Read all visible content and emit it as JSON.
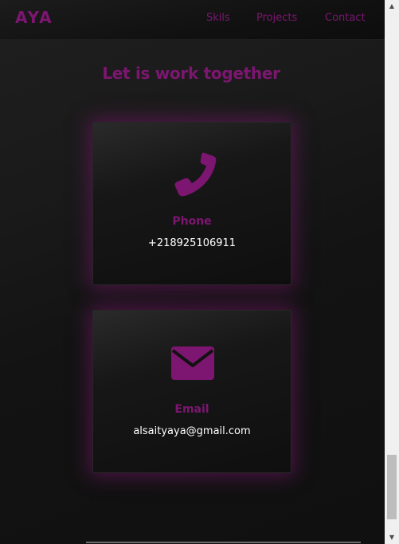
{
  "nav": {
    "logo": "AYA",
    "links": [
      "Skils",
      "Projects",
      "Contact"
    ]
  },
  "contact": {
    "title": "Let is work together",
    "cards": [
      {
        "icon": "phone-icon",
        "label": "Phone",
        "value": "+218925106911"
      },
      {
        "icon": "envelope-icon",
        "label": "Email",
        "value": "alsaityaya@gmail.com"
      }
    ]
  },
  "colors": {
    "accent": "#7c1670",
    "background": "#121212",
    "text": "#ffffff"
  }
}
